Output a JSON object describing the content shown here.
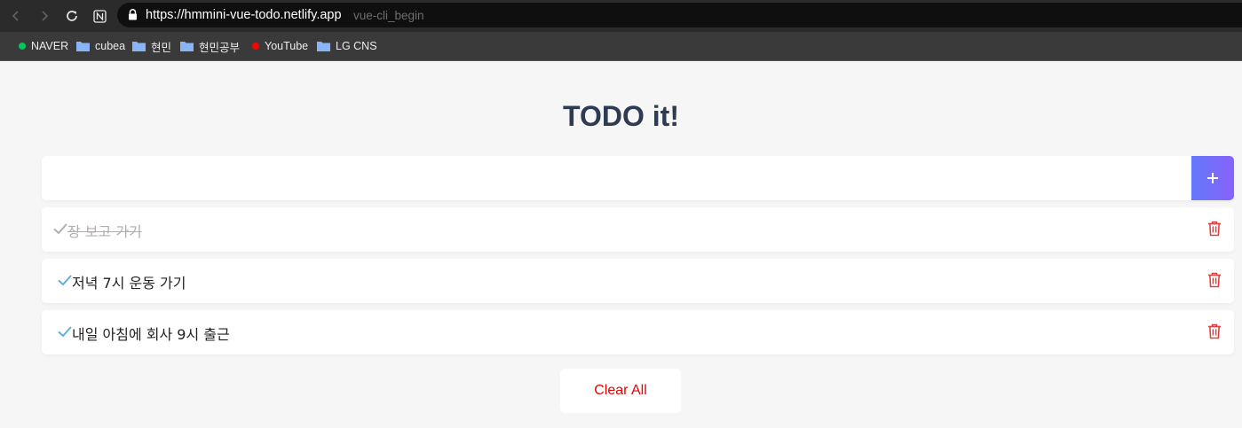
{
  "browser": {
    "url": "https://hmmini-vue-todo.netlify.app",
    "url_hint": "vue-cli_begin",
    "bookmarks": [
      {
        "label": "NAVER",
        "icon": "green-dot-icon",
        "color": "#03c75a"
      },
      {
        "label": "cubea",
        "icon": "folder-icon"
      },
      {
        "label": "현민",
        "icon": "folder-icon"
      },
      {
        "label": "현민공부",
        "icon": "folder-icon"
      },
      {
        "label": "YouTube",
        "icon": "red-dot-icon",
        "color": "#ff0000"
      },
      {
        "label": "LG CNS",
        "icon": "folder-icon"
      }
    ]
  },
  "app": {
    "title": "TODO it!",
    "input": {
      "value": "",
      "placeholder": ""
    },
    "add_button_icon": "plus-icon",
    "accent_gradient": [
      "#6478fb",
      "#8763fb"
    ],
    "check_color_active": "#62acde",
    "check_color_done": "#b3adad",
    "trash_color": "#de4343",
    "todos": [
      {
        "text": "장 보고 가기",
        "completed": true
      },
      {
        "text": "저녁 7시 운동 가기",
        "completed": false
      },
      {
        "text": "내일 아침에 회사 9시 출근",
        "completed": false
      }
    ],
    "clear_label": "Clear All"
  }
}
